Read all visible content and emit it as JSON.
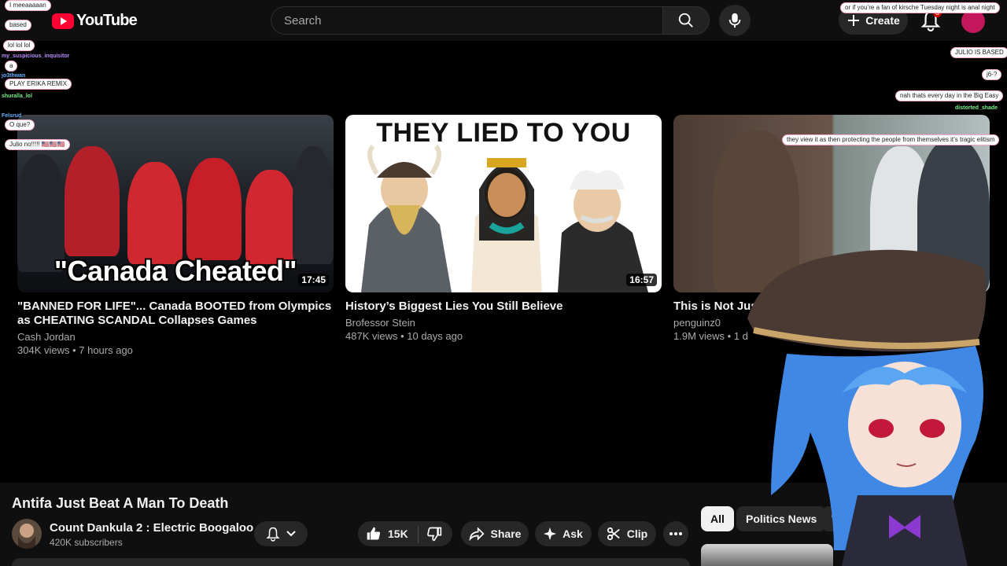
{
  "header": {
    "logo_text": "YouTube",
    "search_placeholder": "Search",
    "create_label": "Create",
    "notification_count": "8"
  },
  "videos": [
    {
      "title": "\"BANNED FOR LIFE\"... Canada BOOTED from Olympics as CHEATING SCANDAL Collapses Games",
      "channel": "Cash Jordan",
      "meta": "304K views • 7 hours ago",
      "duration": "17:45",
      "thumb_text": "\"Canada Cheated\""
    },
    {
      "title": "History’s Biggest Lies You Still Believe",
      "channel": "Brofessor Stein",
      "meta": "487K views • 10 days ago",
      "duration": "16:57",
      "thumb_text": "THEY LIED TO YOU"
    },
    {
      "title": "This is Not Justi",
      "channel": "penguinz0",
      "meta": "1.9M views • 1 d"
    }
  ],
  "watch": {
    "title": "Antifa Just Beat A Man To Death",
    "channel_name": "Count Dankula 2 : Electric Boogaloo",
    "subscribers": "420K subscribers",
    "like_count": "15K",
    "share_label": "Share",
    "ask_label": "Ask",
    "clip_label": "Clip"
  },
  "chips": [
    "All",
    "Politics News",
    "Wo"
  ],
  "chat": {
    "left": [
      {
        "name": "",
        "text": "I meeaaaaan"
      },
      {
        "name": "",
        "text": "based"
      },
      {
        "name": "",
        "text": "lol lol lol"
      },
      {
        "name": "my_suspicious_inquisitor",
        "text": "a"
      },
      {
        "name": "jo3thwan",
        "text": "PLAY ERIKA REMIX"
      },
      {
        "name": "shuralla_lol",
        "text": ""
      },
      {
        "name": "Felsrud",
        "text": "O que?"
      },
      {
        "name": "",
        "text": "Julio no!!!!! 🇺🇸🇺🇸🇺🇸"
      }
    ],
    "right": [
      {
        "name": "",
        "text": "or if you’re a fan of kirsche Tuesday night is anal night"
      },
      {
        "name": "",
        "text": "JULIO IS BASED"
      },
      {
        "name": "",
        "text": "j6-?"
      },
      {
        "name": "",
        "text": "nah thats every day in the Big Easy"
      },
      {
        "name": "distorted_shade",
        "text": ""
      },
      {
        "name": "",
        "text": "they view it as then protecting the people from themselves it’s tragic elitism"
      }
    ]
  },
  "colors": {
    "accent": "#ff0033",
    "background": "#0f0f0f",
    "surface": "#272727"
  }
}
